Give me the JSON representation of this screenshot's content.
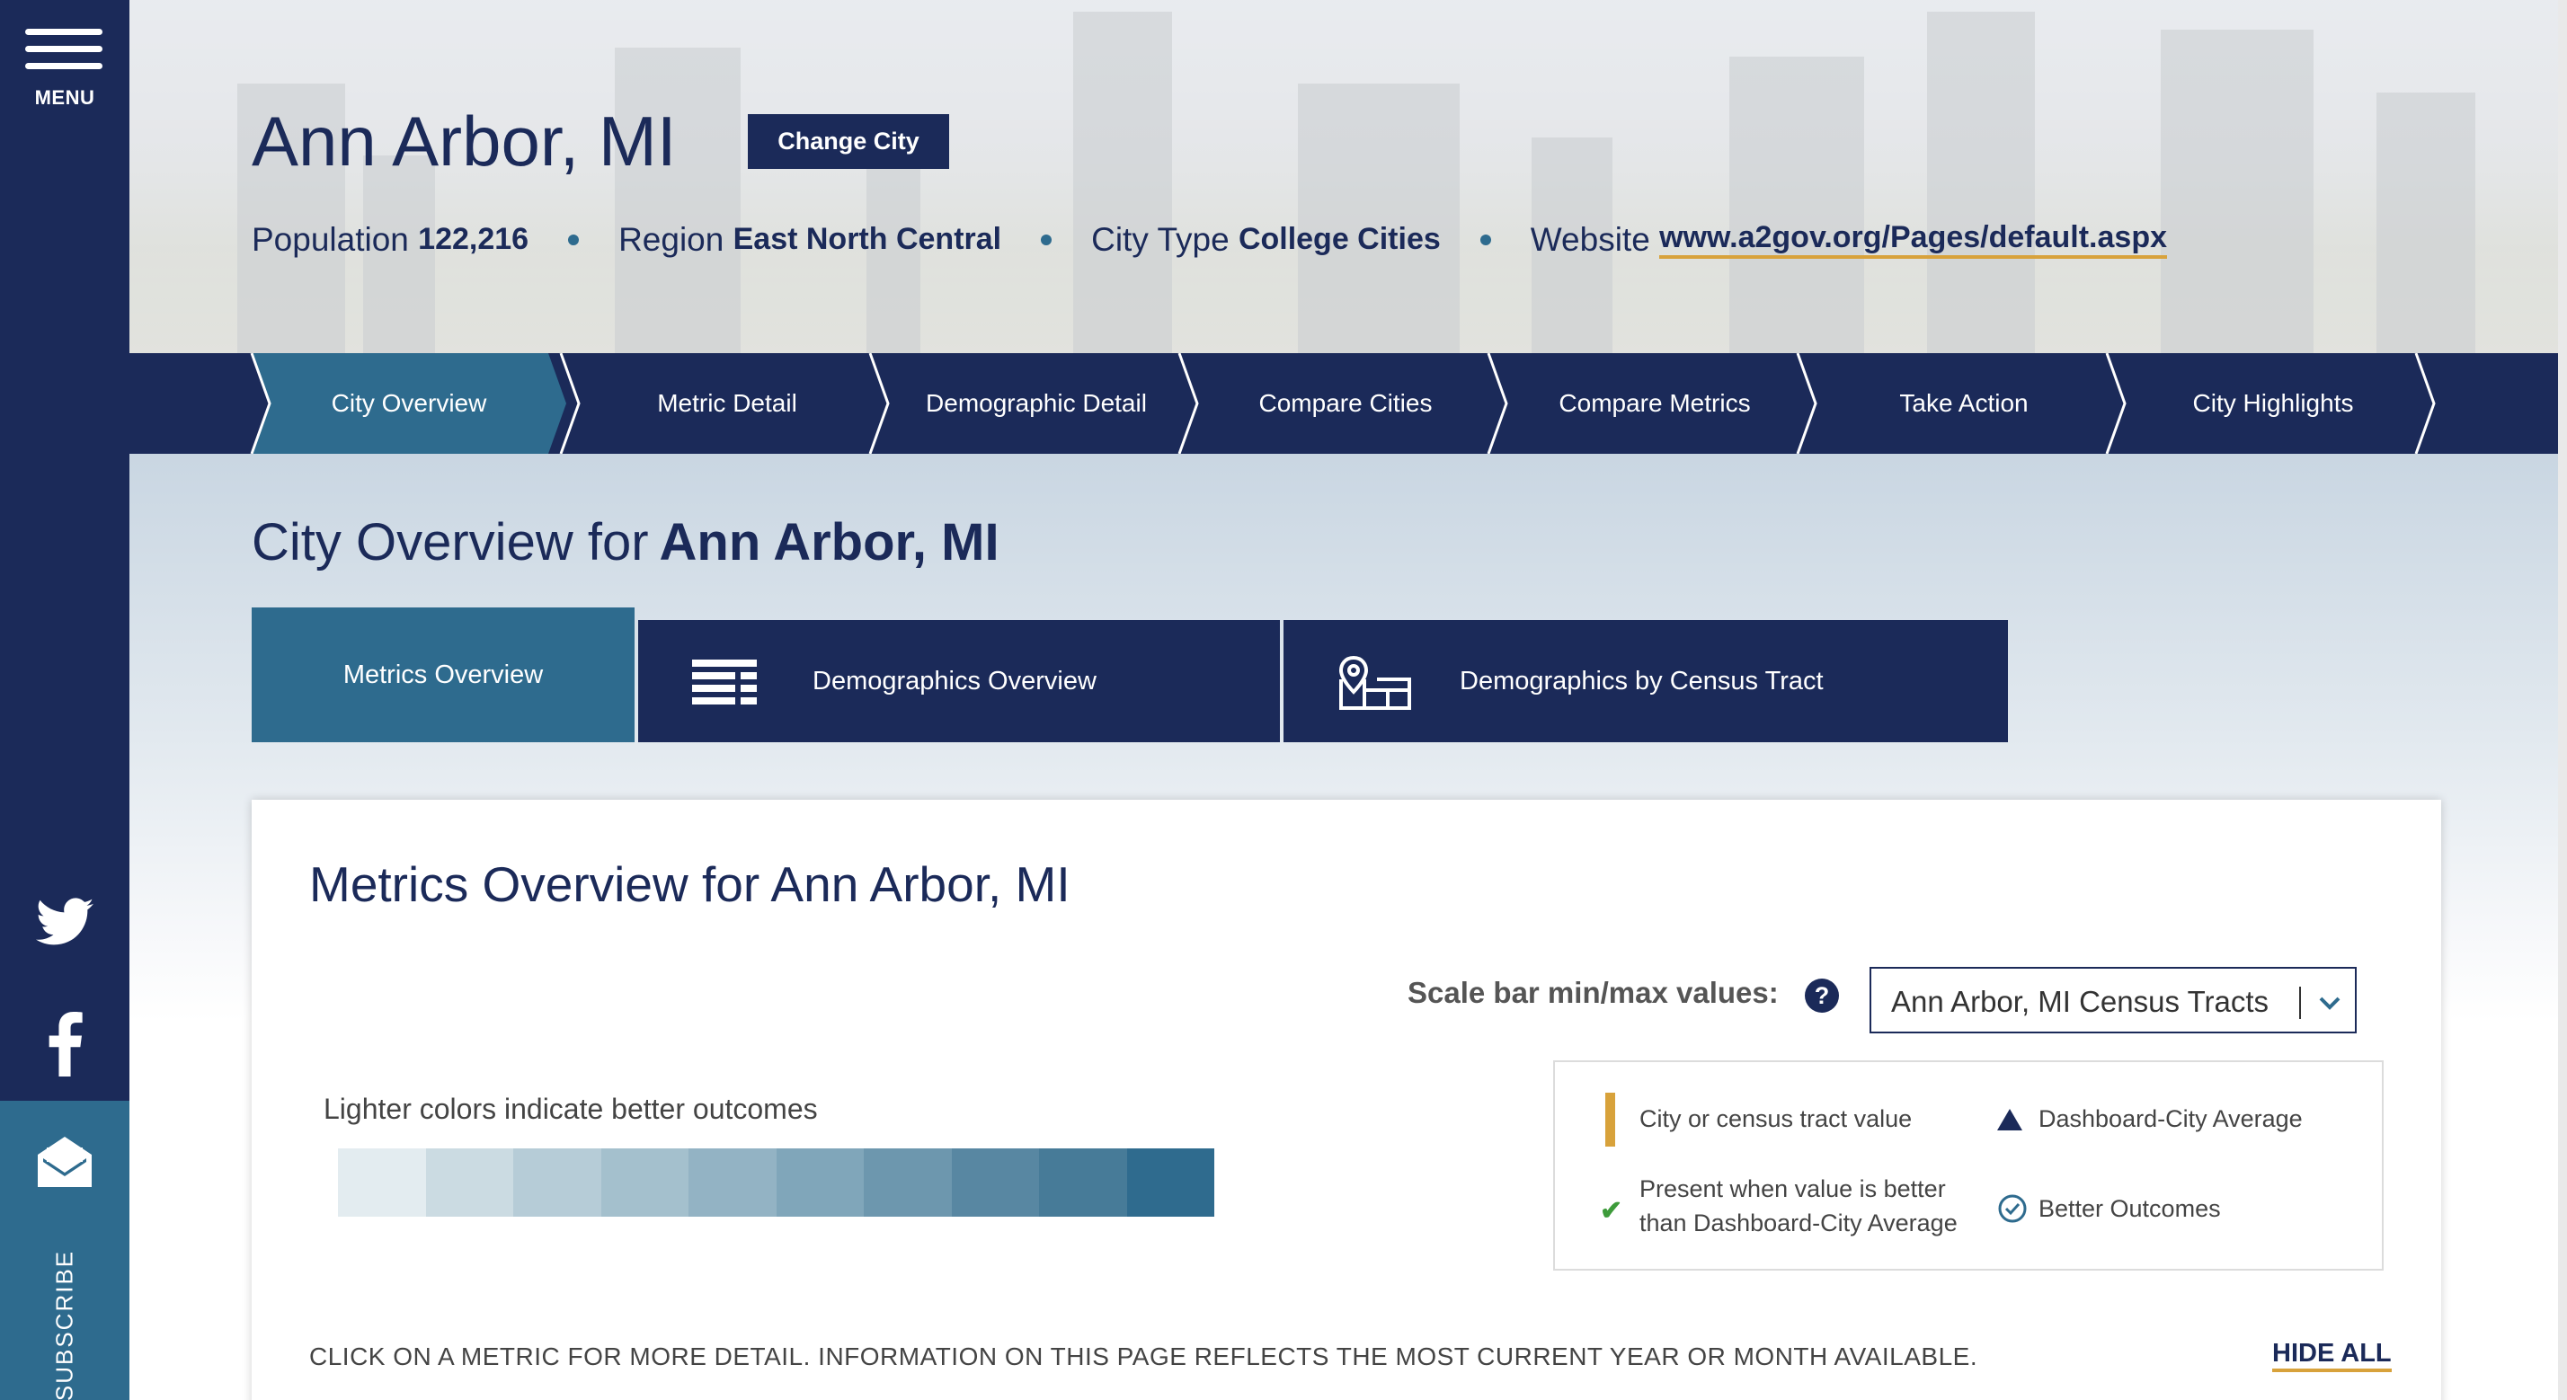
{
  "sidebar": {
    "menu_label": "MENU",
    "subscribe_label": "SUBSCRIBE",
    "icons": [
      "menu-icon",
      "twitter-icon",
      "facebook-icon",
      "envelope-icon"
    ]
  },
  "hero": {
    "city_name": "Ann Arbor, MI",
    "change_city_label": "Change City",
    "facts": {
      "population_label": "Population",
      "population_value": "122,216",
      "region_label": "Region",
      "region_value": "East North Central",
      "city_type_label": "City Type",
      "city_type_value": "College Cities",
      "website_label": "Website",
      "website_value": "www.a2gov.org/Pages/default.aspx"
    }
  },
  "nav": {
    "tabs": [
      {
        "label": "City Overview",
        "active": true
      },
      {
        "label": "Metric Detail",
        "active": false
      },
      {
        "label": "Demographic Detail",
        "active": false
      },
      {
        "label": "Compare Cities",
        "active": false
      },
      {
        "label": "Compare Metrics",
        "active": false
      },
      {
        "label": "Take Action",
        "active": false
      },
      {
        "label": "City Highlights",
        "active": false
      }
    ]
  },
  "overview": {
    "title_prefix": "City Overview for",
    "title_city": "Ann Arbor, MI",
    "subtabs": [
      {
        "label": "Metrics Overview",
        "active": true,
        "icon": ""
      },
      {
        "label": "Demographics Overview",
        "active": false,
        "icon": "table-grid-icon"
      },
      {
        "label": "Demographics by Census Tract",
        "active": false,
        "icon": "map-pin-icon"
      }
    ]
  },
  "card": {
    "title": "Metrics Overview for Ann Arbor, MI",
    "scale_label": "Scale bar min/max values:",
    "help_icon_text": "?",
    "scale_select_value": "Ann Arbor, MI Census Tracts",
    "lighter_label": "Lighter colors indicate better outcomes",
    "color_scale": [
      "#e3ecf0",
      "#cbdbe2",
      "#b6ccd7",
      "#a4c0cd",
      "#93b3c4",
      "#80a6ba",
      "#6d97ae",
      "#5887a2",
      "#477b98",
      "#2f6b8e"
    ],
    "legend": {
      "city_value": "City or census tract value",
      "dashboard_avg": "Dashboard-City Average",
      "present_better_line1": "Present when value is better",
      "present_better_line2": "than Dashboard-City Average",
      "better_outcomes": "Better Outcomes"
    },
    "instructions": "CLICK ON A METRIC FOR MORE DETAIL. INFORMATION ON THIS PAGE REFLECTS THE MOST CURRENT YEAR OR MONTH AVAILABLE.",
    "hide_all_label": "HIDE ALL"
  },
  "colors": {
    "navy": "#1b2a59",
    "teal": "#2e6b8e",
    "gold": "#d8a23b",
    "green_check": "#3d9b3a"
  }
}
